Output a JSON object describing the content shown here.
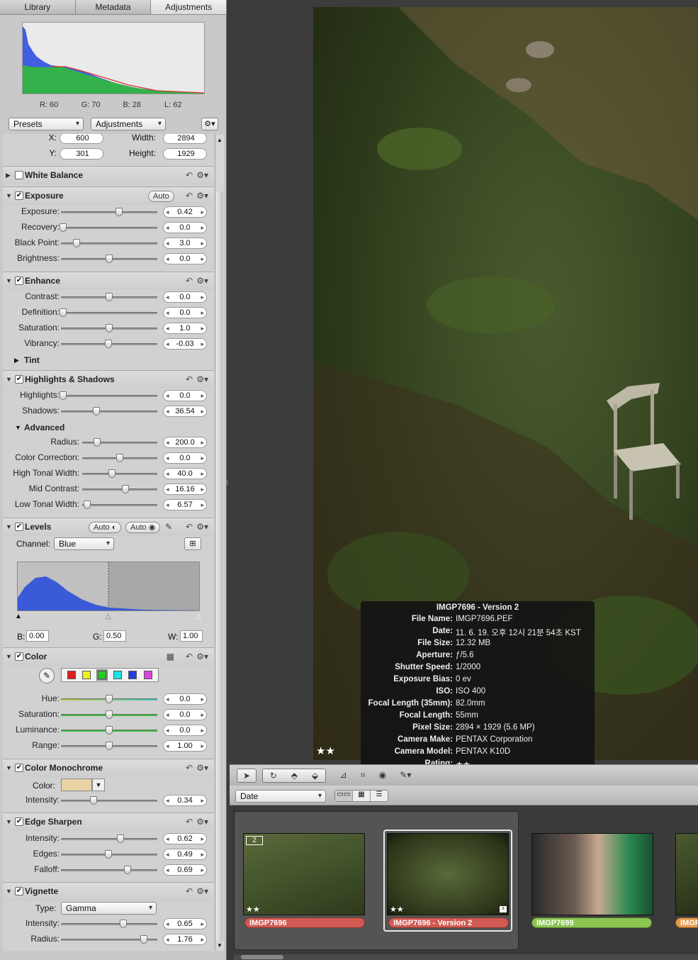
{
  "tabs": [
    "Library",
    "Metadata",
    "Adjustments"
  ],
  "histogram": {
    "r": "R: 60",
    "g": "G: 70",
    "b": "B: 28",
    "l": "L: 62"
  },
  "presets_label": "Presets",
  "adjustments_label": "Adjustments",
  "crop": {
    "x_label": "X:",
    "x": "600",
    "y_label": "Y:",
    "y": "301",
    "w_label": "Width:",
    "w": "2894",
    "h_label": "Height:",
    "h": "1929"
  },
  "sections": {
    "white_balance": "White Balance",
    "exposure": {
      "title": "Exposure",
      "auto": "Auto",
      "rows": [
        {
          "label": "Exposure:",
          "value": "0.42",
          "pos": 0.6
        },
        {
          "label": "Recovery:",
          "value": "0.0",
          "pos": 0.02
        },
        {
          "label": "Black Point:",
          "value": "3.0",
          "pos": 0.16
        },
        {
          "label": "Brightness:",
          "value": "0.0",
          "pos": 0.5
        }
      ]
    },
    "enhance": {
      "title": "Enhance",
      "rows": [
        {
          "label": "Contrast:",
          "value": "0.0",
          "pos": 0.5
        },
        {
          "label": "Definition:",
          "value": "0.0",
          "pos": 0.02
        },
        {
          "label": "Saturation:",
          "value": "1.0",
          "pos": 0.5
        },
        {
          "label": "Vibrancy:",
          "value": "-0.03",
          "pos": 0.49
        }
      ],
      "tint": "Tint"
    },
    "highlights": {
      "title": "Highlights & Shadows",
      "rows": [
        {
          "label": "Highlights:",
          "value": "0.0",
          "pos": 0.02
        },
        {
          "label": "Shadows:",
          "value": "36.54",
          "pos": 0.37
        }
      ],
      "advanced": "Advanced",
      "adv_rows": [
        {
          "label": "Radius:",
          "value": "200.0",
          "pos": 0.2
        },
        {
          "label": "Color Correction:",
          "value": "0.0",
          "pos": 0.5
        },
        {
          "label": "High Tonal Width:",
          "value": "40.0",
          "pos": 0.4
        },
        {
          "label": "Mid Contrast:",
          "value": "16.16",
          "pos": 0.58
        },
        {
          "label": "Low Tonal Width:",
          "value": "6.57",
          "pos": 0.07
        }
      ]
    },
    "levels": {
      "title": "Levels",
      "auto1": "Auto",
      "auto2": "Auto",
      "channel_label": "Channel:",
      "channel": "Blue",
      "b_label": "B:",
      "b": "0.00",
      "g_label": "G:",
      "g": "0.50",
      "w_label": "W:",
      "w": "1.00"
    },
    "color": {
      "title": "Color",
      "swatches": [
        "#e02020",
        "#f0f020",
        "#20d020",
        "#20e0e0",
        "#2040e0",
        "#e040e0"
      ],
      "rows": [
        {
          "label": "Hue:",
          "value": "0.0",
          "pos": 0.5
        },
        {
          "label": "Saturation:",
          "value": "0.0",
          "pos": 0.5
        },
        {
          "label": "Luminance:",
          "value": "0.0",
          "pos": 0.5
        },
        {
          "label": "Range:",
          "value": "1.00",
          "pos": 0.5
        }
      ]
    },
    "mono": {
      "title": "Color Monochrome",
      "color_label": "Color:",
      "swatch": "#e8d2a6",
      "rows": [
        {
          "label": "Intensity:",
          "value": "0.34",
          "pos": 0.34
        }
      ]
    },
    "sharpen": {
      "title": "Edge Sharpen",
      "rows": [
        {
          "label": "Intensity:",
          "value": "0.62",
          "pos": 0.62
        },
        {
          "label": "Edges:",
          "value": "0.49",
          "pos": 0.49
        },
        {
          "label": "Falloff:",
          "value": "0.69",
          "pos": 0.69
        }
      ]
    },
    "vignette": {
      "title": "Vignette",
      "type_label": "Type:",
      "type": "Gamma",
      "rows": [
        {
          "label": "Intensity:",
          "value": "0.65",
          "pos": 0.65
        },
        {
          "label": "Radius:",
          "value": "1.76",
          "pos": 0.86
        }
      ]
    }
  },
  "info": {
    "title": "IMGP7696 - Version 2",
    "rows": [
      {
        "k": "File Name:",
        "v": "IMGP7696.PEF"
      },
      {
        "k": "Date:",
        "v": "11. 6. 19. 오후 12시 21분 54초 KST"
      },
      {
        "k": "File Size:",
        "v": "12.32 MB"
      },
      {
        "k": "Aperture:",
        "v": "ƒ/5.6"
      },
      {
        "k": "Shutter Speed:",
        "v": "1/2000"
      },
      {
        "k": "Exposure Bias:",
        "v": "0 ev"
      },
      {
        "k": "ISO:",
        "v": "ISO 400"
      },
      {
        "k": "Focal Length (35mm):",
        "v": "82.0mm"
      },
      {
        "k": "Focal Length:",
        "v": "55mm"
      },
      {
        "k": "Pixel Size:",
        "v": "2894 × 1929 (5.6 MP)"
      },
      {
        "k": "Camera Make:",
        "v": "PENTAX Corporation"
      },
      {
        "k": "Camera Model:",
        "v": "PENTAX K10D"
      },
      {
        "k": "Rating:",
        "v": "★★"
      }
    ]
  },
  "viewer_rating": "★★",
  "sort": "Date",
  "thumbs": [
    {
      "name": "IMGP7696",
      "stars": "★★",
      "badge": "2",
      "color": "#d05a52"
    },
    {
      "name": "IMGP7696 - Version 2",
      "stars": "★★",
      "color": "#d05a52"
    },
    {
      "name": "IMGP7699",
      "color": "#8cc552"
    },
    {
      "name": "IMGP",
      "color": "#e59a4a"
    }
  ]
}
